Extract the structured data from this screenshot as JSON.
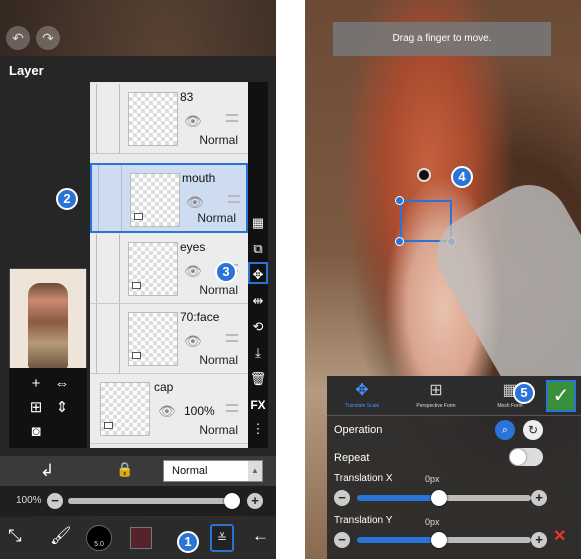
{
  "left": {
    "layer_window": {
      "title": "Layer",
      "layers": [
        {
          "name": "83",
          "blend": "Normal",
          "opacity": "",
          "selected": false
        },
        {
          "name": "mouth",
          "blend": "Normal",
          "opacity": "",
          "selected": true
        },
        {
          "name": "eyes",
          "blend": "Normal",
          "opacity": "",
          "selected": false
        },
        {
          "name": "70:face",
          "blend": "Normal",
          "opacity": "",
          "selected": false
        },
        {
          "name": "cap",
          "blend": "Normal",
          "opacity": "100%",
          "selected": false
        }
      ],
      "side_tool_fx": "FX"
    },
    "blend_bar": {
      "blend_mode": "Normal"
    },
    "opacity_bar": {
      "label": "100%",
      "value_percent": 100
    },
    "bottom_toolbar": {
      "brush_size": "5.0",
      "color": "#55232b"
    },
    "steps": {
      "s1": "1",
      "s2": "2",
      "s3": "3"
    }
  },
  "right": {
    "hint": "Drag a finger to move.",
    "tabs": [
      {
        "label": "Translate Scale",
        "icon": "move-icon",
        "active": true
      },
      {
        "label": "Perspective Form",
        "icon": "perspective-icon",
        "active": false
      },
      {
        "label": "Mesh Form",
        "icon": "mesh-icon",
        "active": false
      }
    ],
    "operation_label": "Operation",
    "repeat_label": "Repeat",
    "translation_x": {
      "label": "Translation X",
      "value": "0px"
    },
    "translation_y": {
      "label": "Translation Y",
      "value": "0px"
    },
    "steps": {
      "s4": "4",
      "s5": "5"
    }
  },
  "colors": {
    "accent": "#2a74d8",
    "confirm": "#3a8f3a",
    "close": "#e33333"
  }
}
